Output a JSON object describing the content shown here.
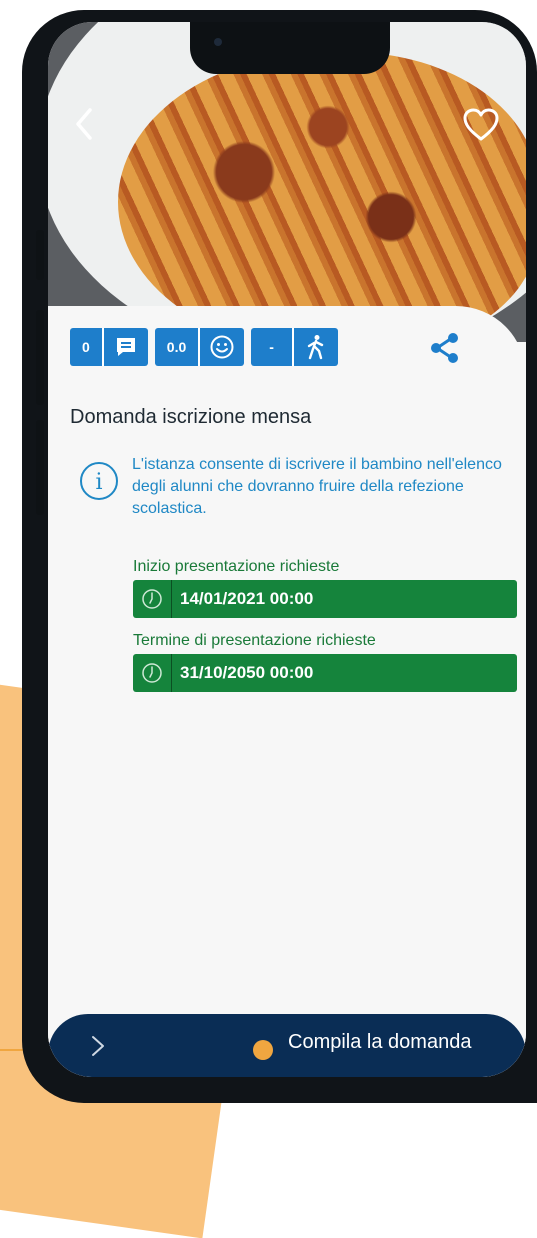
{
  "header": {
    "back_icon": "chevron-left-icon",
    "favorite_icon": "heart-outline-icon"
  },
  "stats": [
    {
      "value": "0",
      "icon": "comment-icon"
    },
    {
      "value": "0.0",
      "icon": "smiley-icon"
    },
    {
      "value": "-",
      "icon": "walking-person-icon"
    }
  ],
  "share_icon": "share-icon",
  "service": {
    "title": "Domanda iscrizione mensa",
    "info_icon": "info-icon",
    "description": "L'istanza consente di iscrivere il bambino nell'elenco degli alunni che dovranno fruire della refezione scolastica."
  },
  "dates": {
    "start_label": "Inizio presentazione richieste",
    "start_value": "14/01/2021 00:00",
    "end_label": "Termine di presentazione richieste",
    "end_value": "31/10/2050 00:00",
    "icon": "clock-icon"
  },
  "footer": {
    "cta_label": "Compila la domanda",
    "arrow_icon": "chevron-right-icon"
  },
  "colors": {
    "primary_blue": "#1e7ecb",
    "date_green": "#15843c",
    "footer_navy": "#0a2d55",
    "accent_orange": "#f9c27d"
  }
}
